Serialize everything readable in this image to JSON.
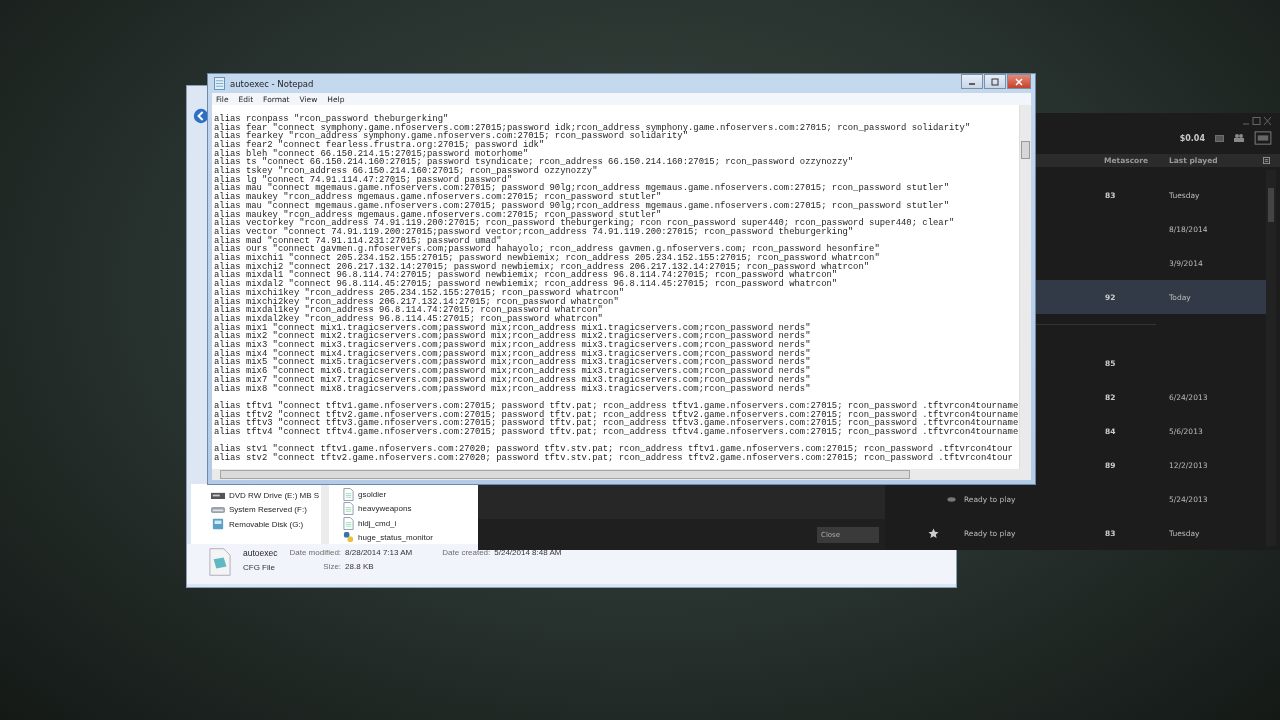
{
  "notepad": {
    "title": "autoexec - Notepad",
    "menu": [
      "File",
      "Edit",
      "Format",
      "View",
      "Help"
    ],
    "blocks": [
      [
        "alias rconpass \"rcon_password theburgerking\"",
        "alias fear \"connect symphony.game.nfoservers.com:27015;password idk;rcon_address symphony.game.nfoservers.com:27015; rcon_password solidarity\"",
        "alias fearkey \"rcon_address symphony.game.nfoservers.com:27015; rcon_password solidarity\"",
        "alias fear2 \"connect fearless.frustra.org:27015; password idk\"",
        "alias bleh \"connect 66.150.214.15:27015;password motorhome\"",
        "alias ts \"connect 66.150.214.160:27015; password tsyndicate; rcon_address 66.150.214.160:27015; rcon_password ozzynozzy\"",
        "alias tskey \"rcon_address 66.150.214.160:27015; rcon_password ozzynozzy\"",
        "alias lg \"connect 74.91.114.47:27015; password password\"",
        "alias mau \"connect mgemaus.game.nfoservers.com:27015; password 90lg;rcon_address mgemaus.game.nfoservers.com:27015; rcon_password stutler\"",
        "alias maukey \"rcon_address mgemaus.game.nfoservers.com:27015; rcon_password stutler\"",
        "alias mau \"connect mgemaus.game.nfoservers.com:27015; password 90lg;rcon_address mgemaus.game.nfoservers.com:27015; rcon_password stutler\"",
        "alias maukey \"rcon_address mgemaus.game.nfoservers.com:27015; rcon_password stutler\"",
        "alias vectorkey \"rcon_address 74.91.119.200:27015; rcon_password theburgerking; rcon rcon_password super440; rcon_password super440; clear\"",
        "alias vector \"connect 74.91.119.200:27015;password vector;rcon_address 74.91.119.200:27015; rcon_password theburgerking\"",
        "alias mad \"connect 74.91.114.231:27015; password umad\"",
        "alias ours \"connect gavmen.g.nfoservers.com;password hahayolo; rcon_address gavmen.g.nfoservers.com; rcon_password hesonfire\"",
        "alias mixchi1 \"connect 205.234.152.155:27015; password newbiemix; rcon_address 205.234.152.155:27015; rcon_password whatrcon\"",
        "alias mixchi2 \"connect 206.217.132.14:27015; password newbiemix; rcon_address 206.217.132.14:27015; rcon_password whatrcon\"",
        "alias mixdal1 \"connect 96.8.114.74:27015; password newbiemix; rcon_address 96.8.114.74:27015; rcon_password whatrcon\"",
        "alias mixdal2 \"connect 96.8.114.45:27015; password newbiemix; rcon_address 96.8.114.45:27015; rcon_password whatrcon\"",
        "alias mixchi1key \"rcon_address 205.234.152.155:27015; rcon_password whatrcon\"",
        "alias mixchi2key \"rcon_address 206.217.132.14:27015; rcon_password whatrcon\"",
        "alias mixdal1key \"rcon_address 96.8.114.74:27015; rcon_password whatrcon\"",
        "alias mixdal2key \"rcon_address 96.8.114.45:27015; rcon_password whatrcon\"",
        "alias mix1 \"connect mix1.tragicservers.com;password mix;rcon_address mix1.tragicservers.com;rcon_password nerds\"",
        "alias mix2 \"connect mix2.tragicservers.com;password mix;rcon_address mix2.tragicservers.com;rcon_password nerds\"",
        "alias mix3 \"connect mix3.tragicservers.com;password mix;rcon_address mix3.tragicservers.com;rcon_password nerds\"",
        "alias mix4 \"connect mix4.tragicservers.com;password mix;rcon_address mix3.tragicservers.com;rcon_password nerds\"",
        "alias mix5 \"connect mix5.tragicservers.com;password mix;rcon_address mix3.tragicservers.com;rcon_password nerds\"",
        "alias mix6 \"connect mix6.tragicservers.com;password mix;rcon_address mix3.tragicservers.com;rcon_password nerds\"",
        "alias mix7 \"connect mix7.tragicservers.com;password mix;rcon_address mix3.tragicservers.com;rcon_password nerds\"",
        "alias mix8 \"connect mix8.tragicservers.com;password mix;rcon_address mix3.tragicservers.com;rcon_password nerds\""
      ],
      [
        "alias tftv1 \"connect tftv1.game.nfoservers.com:27015; password tftv.pat; rcon_address tftv1.game.nfoservers.com:27015; rcon_password .tftvrcon4tourname",
        "alias tftv2 \"connect tftv2.game.nfoservers.com:27015; password tftv.pat; rcon_address tftv2.game.nfoservers.com:27015; rcon_password .tftvrcon4tourname",
        "alias tftv3 \"connect tftv3.game.nfoservers.com:27015; password tftv.pat; rcon_address tftv3.game.nfoservers.com:27015; rcon_password .tftvrcon4tourname",
        "alias tftv4 \"connect tftv4.game.nfoservers.com:27015; password tftv.pat; rcon_address tftv4.game.nfoservers.com:27015; rcon_password .tftvrcon4tourname"
      ],
      [
        "alias stv1 \"connect tftv1.game.nfoservers.com:27020; password tftv.stv.pat; rcon_address tftv1.game.nfoservers.com:27015; rcon_password .tftvrcon4tour",
        "alias stv2 \"connect tftv2.game.nfoservers.com:27020; password tftv.stv.pat; rcon_address tftv2.game.nfoservers.com:27015; rcon_password .tftvrcon4tour"
      ]
    ]
  },
  "explorer": {
    "drives": [
      {
        "kind": "dvd",
        "label": "DVD RW Drive (E:) MB S"
      },
      {
        "kind": "disk",
        "label": "System Reserved (F:)"
      },
      {
        "kind": "usb",
        "label": "Removable Disk (G:)"
      }
    ],
    "files": [
      {
        "kind": "doc",
        "name": "gsoldier"
      },
      {
        "kind": "doc",
        "name": "heavyweapons"
      },
      {
        "kind": "doc",
        "name": "hldj_cmd_i"
      },
      {
        "kind": "script",
        "name": "huge_status_monitor"
      }
    ],
    "details": {
      "name": "autoexec",
      "type": "CFG File",
      "modified_label": "Date modified:",
      "modified": "8/28/2014 7:13 AM",
      "size_label": "Size:",
      "size": "28.8 KB",
      "created_label": "Date created:",
      "created": "5/24/2014 8:48 AM"
    }
  },
  "dialog": {
    "button": "Close"
  },
  "steam": {
    "balance": "$0.04",
    "columns": [
      "Metascore",
      "Last played"
    ],
    "rows": [
      {
        "kind": "plain",
        "metascore": "83",
        "last_played": "Tuesday",
        "selected": false,
        "group_break": false
      },
      {
        "kind": "plain",
        "last_played": "8/18/2014",
        "selected": false,
        "group_break": false
      },
      {
        "kind": "plain",
        "last_played": "3/9/2014",
        "selected": false,
        "group_break": false
      },
      {
        "kind": "plain",
        "metascore": "92",
        "last_played": "Today",
        "selected": true,
        "group_break": false
      },
      {
        "kind": "plain",
        "metascore": "85",
        "selected": false,
        "group_break": true
      },
      {
        "kind": "plain",
        "metascore": "82",
        "last_played": "6/24/2013",
        "selected": false,
        "group_break": false
      },
      {
        "kind": "plain",
        "metascore": "84",
        "last_played": "5/6/2013",
        "selected": false,
        "group_break": false
      },
      {
        "kind": "plain",
        "metascore": "89",
        "last_played": "12/2/2013",
        "selected": false,
        "group_break": false
      },
      {
        "kind": "ready",
        "status": "Ready to play",
        "last_played": "5/24/2013",
        "selected": false,
        "group_break": false
      },
      {
        "kind": "favorite",
        "status": "Ready to play",
        "metascore": "83",
        "last_played": "Tuesday",
        "selected": false,
        "group_break": false
      }
    ]
  }
}
